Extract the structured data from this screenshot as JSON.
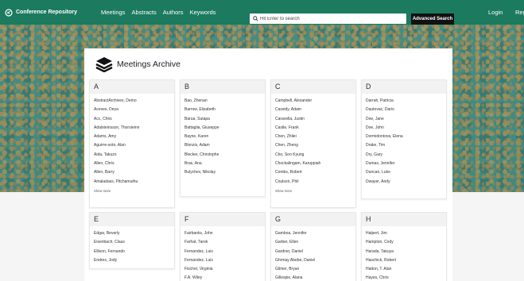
{
  "nav": {
    "brand": "Conference Repository",
    "links": [
      "Meetings",
      "Abstracts",
      "Authors",
      "Keywords"
    ],
    "search_placeholder": "Hit Enter to search",
    "advanced_search": "Advanced Search",
    "login": "Login",
    "register": "Regi"
  },
  "panel": {
    "title": "Meetings Archive"
  },
  "columns": [
    {
      "letter": "A",
      "names": [
        "AbstractArchives, Demo",
        "Aceves, Deya",
        "Acc, Chris",
        "Adalsteinsson, Thorsteinn",
        "Adams, Amy",
        "Aguirre-soto, Alan",
        "Aida, Takuzo",
        "Allen, Chris",
        "Allen, Barry",
        "Amaladass, Pitchamuthu"
      ],
      "more": "Show more"
    },
    {
      "letter": "B",
      "names": [
        "Bao, Zhenan",
        "Barrow, Elizabeth",
        "Barua, Sutapa",
        "Battaglia, Giuseppe",
        "Bayne, Karen",
        "Blonzis, Adam",
        "Blecker, Christophe",
        "Bras, Ana",
        "Bulychev, Nikolay"
      ],
      "more": ""
    },
    {
      "letter": "C",
      "names": [
        "Campbell, Alexander",
        "Cassidy, Adam",
        "Caravella, Justin",
        "Castle, Frank",
        "Chen, Zhilei",
        "Chen, Zheng",
        "Cho, Soo Kyung",
        "Chockalingam, Karuppiah",
        "Combs, Robert",
        "Coulson, Phil"
      ],
      "more": "Show more"
    },
    {
      "letter": "D",
      "names": [
        "Darrah, Patricia",
        "Dautovac, Dario",
        "Doe, Jane",
        "Doe, John",
        "Dormidontova, Elena",
        "Drake, Tim",
        "Dry, Gary",
        "Dumas, Jennifer",
        "Duncan, Luke",
        "Dwayer, Andy"
      ],
      "more": ""
    },
    {
      "letter": "E",
      "names": [
        "Edgar, Beverly",
        "Eisenbach, Claus",
        "Ellison, Fernando",
        "Endres, Jody"
      ],
      "more": ""
    },
    {
      "letter": "F",
      "names": [
        "Fairbanks, John",
        "Farhat, Tarek",
        "Fernandez, Luis",
        "Fernandez, Luis",
        "Fischer, Virginia",
        "F.A. Wiley"
      ],
      "more": ""
    },
    {
      "letter": "G",
      "names": [
        "Gamboa, Jennifer",
        "Garber, Ellen",
        "Gardner, Daniel",
        "Ghrmay Abebe, Daniel",
        "Gilmer, Bryan",
        "Gillespie, Alana"
      ],
      "more": ""
    },
    {
      "letter": "H",
      "names": [
        "Halpert, Jim",
        "Hampton, Cody",
        "Harada, Takuya",
        "Haschick, Robert",
        "Hatton, T. Alan",
        "Hayes, Chris"
      ],
      "more": ""
    }
  ]
}
